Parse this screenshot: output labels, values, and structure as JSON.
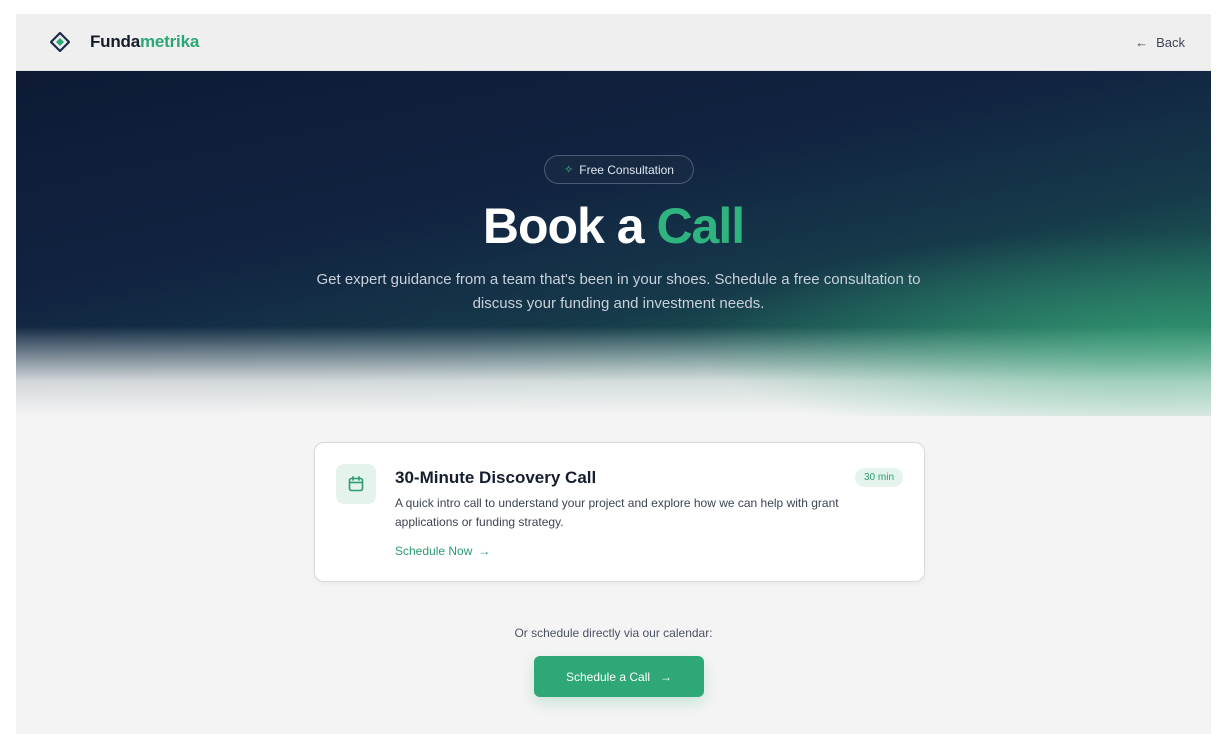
{
  "header": {
    "brand_primary": "Funda",
    "brand_secondary": "metrika",
    "back_label": "Back",
    "back_icon": "arrow-left-icon"
  },
  "hero": {
    "badge_label": "Free Consultation",
    "badge_icon": "sparkle-icon",
    "title_main": "Book a",
    "title_accent": "Call",
    "subtitle": "Get expert guidance from a team that's been in your shoes. Schedule a free consultation to discuss your funding and investment needs."
  },
  "card": {
    "icon": "calendar-icon",
    "title": "30-Minute Discovery Call",
    "duration": "30 min",
    "description": "A quick intro call to understand your project and explore how we can help with grant applications or funding strategy.",
    "link_label": "Schedule Now"
  },
  "bottom": {
    "or_text": "Or schedule directly via our calendar:",
    "button_label": "Schedule a Call"
  },
  "colors": {
    "accent": "#2fa878",
    "accent_text": "#2aa776",
    "hero_dark": "#0e1a34",
    "background": "#f4f4f4"
  }
}
